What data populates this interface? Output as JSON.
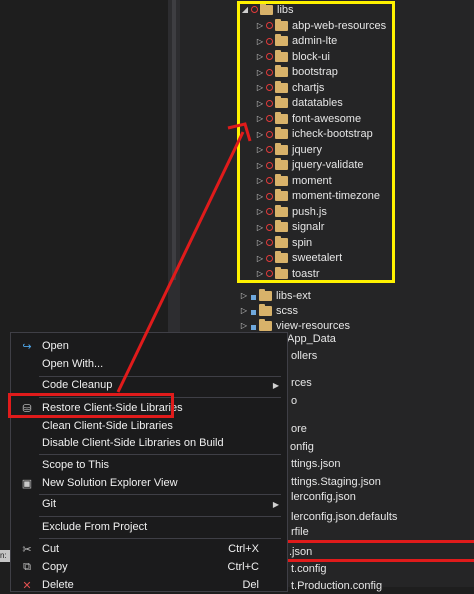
{
  "tree": {
    "root": "libs",
    "items": [
      "abp-web-resources",
      "admin-lte",
      "block-ui",
      "bootstrap",
      "chartjs",
      "datatables",
      "font-awesome",
      "icheck-bootstrap",
      "jquery",
      "jquery-validate",
      "moment",
      "moment-timezone",
      "push.js",
      "signalr",
      "spin",
      "sweetalert",
      "toastr"
    ],
    "siblings": [
      "libs-ext",
      "scss",
      "view-resources"
    ]
  },
  "partial_items": [
    "App_Data",
    "ollers",
    "rces",
    "o",
    "ore",
    "onfig",
    "ttings.json",
    "ttings.Staging.json",
    "lerconfig.json",
    "lerconfig.json.defaults",
    "rfile",
    ".json",
    "t.config",
    "t.Production.config"
  ],
  "menu": {
    "open": "Open",
    "open_with": "Open With...",
    "code_cleanup": "Code Cleanup",
    "restore": "Restore Client-Side Libraries",
    "clean": "Clean Client-Side Libraries",
    "disable": "Disable Client-Side Libraries on Build",
    "scope": "Scope to This",
    "new_view": "New Solution Explorer View",
    "git": "Git",
    "exclude": "Exclude From Project",
    "cut": "Cut",
    "cut_sc": "Ctrl+X",
    "copy": "Copy",
    "copy_sc": "Ctrl+C",
    "delete": "Delete",
    "delete_sc": "Del"
  },
  "status_left": "n:",
  "colors": {
    "highlight_yellow": "#fff200",
    "annotation_red": "#e01b1b",
    "folder": "#d8b26a"
  }
}
